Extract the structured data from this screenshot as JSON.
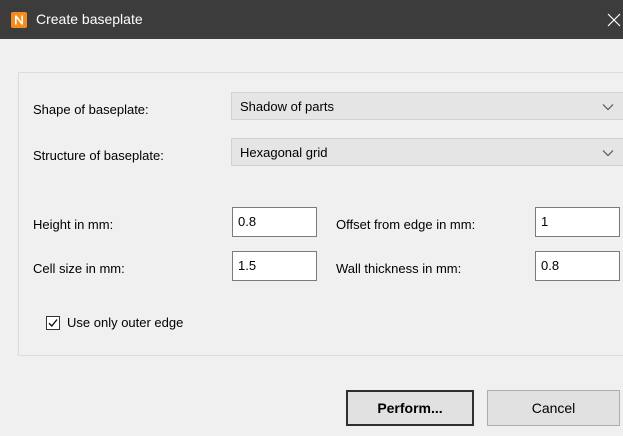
{
  "window": {
    "title": "Create baseplate",
    "icon": "app-n-logo-icon",
    "accent": "#f28c1c"
  },
  "form": {
    "shape": {
      "label": "Shape of baseplate:",
      "value": "Shadow of parts"
    },
    "structure": {
      "label": "Structure of baseplate:",
      "value": "Hexagonal grid"
    },
    "height": {
      "label": "Height in mm:",
      "value": "0.8"
    },
    "cell_size": {
      "label": "Cell size in mm:",
      "value": "1.5"
    },
    "offset": {
      "label": "Offset from edge in mm:",
      "value": "1"
    },
    "wall_thickness": {
      "label": "Wall thickness in mm:",
      "value": "0.8"
    },
    "outer_edge": {
      "label": "Use only outer edge",
      "checked": true
    }
  },
  "buttons": {
    "perform": "Perform...",
    "cancel": "Cancel"
  }
}
